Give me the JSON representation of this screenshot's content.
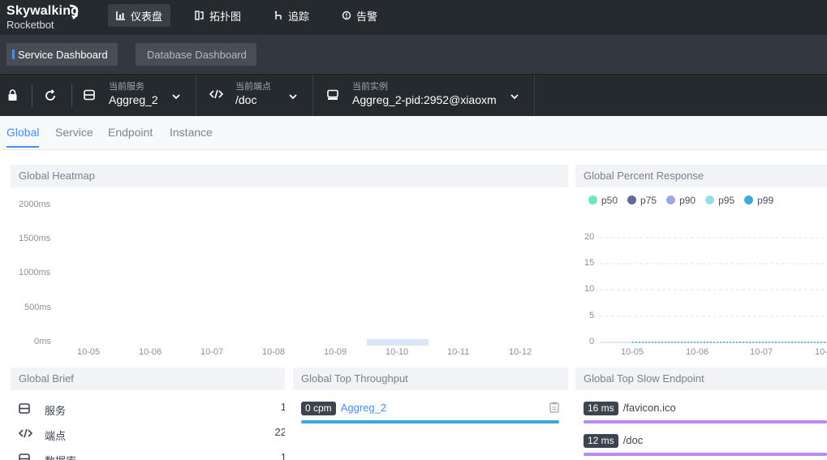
{
  "app": {
    "logo_line1": "Skywalking",
    "logo_line2": "Rocketbot"
  },
  "nav": [
    {
      "label": "仪表盘",
      "icon": "chart-icon"
    },
    {
      "label": "拓扑图",
      "icon": "topology-icon"
    },
    {
      "label": "追踪",
      "icon": "trace-icon"
    },
    {
      "label": "告警",
      "icon": "alarm-icon"
    }
  ],
  "dashboards": [
    "Service Dashboard",
    "Database Dashboard"
  ],
  "selectors": {
    "service": {
      "caption": "当前服务",
      "value": "Aggreg_2"
    },
    "endpoint": {
      "caption": "当前端点",
      "value": "/doc"
    },
    "instance": {
      "caption": "当前实例",
      "value": "Aggreg_2-pid:2952@xiaoxm"
    }
  },
  "subtabs": [
    "Global",
    "Service",
    "Endpoint",
    "Instance"
  ],
  "heatmap": {
    "title": "Global Heatmap",
    "y_labels": [
      "2000ms",
      "1500ms",
      "1000ms",
      "500ms",
      "0ms"
    ],
    "x_labels": [
      "10-05",
      "10-06",
      "10-07",
      "10-08",
      "10-09",
      "10-10",
      "10-11",
      "10-12"
    ]
  },
  "percent": {
    "title": "Global Percent Response",
    "legend": [
      {
        "name": "p50",
        "color": "#6be6c1"
      },
      {
        "name": "p75",
        "color": "#626c91"
      },
      {
        "name": "p90",
        "color": "#a0a7e6"
      },
      {
        "name": "p95",
        "color": "#96dee8"
      },
      {
        "name": "p99",
        "color": "#3fa7dc"
      }
    ],
    "y_labels": [
      "20",
      "15",
      "10",
      "5",
      "0"
    ],
    "x_labels": [
      "10-05",
      "10-06",
      "10-07",
      "10-"
    ]
  },
  "brief": {
    "title": "Global Brief",
    "rows": [
      {
        "label": "服务",
        "value": "1",
        "icon": "database-icon"
      },
      {
        "label": "端点",
        "value": "22",
        "icon": "code-icon"
      },
      {
        "label": "数据库",
        "value": "1",
        "icon": "database-icon"
      }
    ]
  },
  "throughput": {
    "title": "Global Top Throughput",
    "items": [
      {
        "badge": "0 cpm",
        "name": "Aggreg_2"
      }
    ]
  },
  "slow": {
    "title": "Global Top Slow Endpoint",
    "items": [
      {
        "badge": "16 ms",
        "path": "/favicon.ico"
      },
      {
        "badge": "12 ms",
        "path": "/doc"
      }
    ]
  },
  "colors": {
    "accent": "#448dfe",
    "topbar": "#252a2f",
    "throughput_bar": "#3aa8e0",
    "slow_bar": "#b98bf2",
    "heatmap_cell": "#d8e6f6"
  },
  "chart_data": [
    {
      "type": "heatmap",
      "title": "Global Heatmap",
      "categories": [
        "10-05",
        "10-06",
        "10-07",
        "10-08",
        "10-09",
        "10-10",
        "10-11",
        "10-12"
      ],
      "y_ticks": [
        "0ms",
        "500ms",
        "1000ms",
        "1500ms",
        "2000ms"
      ],
      "ylim": [
        0,
        2000
      ],
      "cells": [
        {
          "x": "10-10",
          "y_range": [
            0,
            100
          ]
        }
      ]
    },
    {
      "type": "line",
      "title": "Global Percent Response",
      "x": [
        "10-05",
        "10-06",
        "10-07"
      ],
      "ylim": [
        0,
        20
      ],
      "series": [
        {
          "name": "p50",
          "values": [
            0,
            0,
            0
          ]
        },
        {
          "name": "p75",
          "values": [
            0,
            0,
            0
          ]
        },
        {
          "name": "p90",
          "values": [
            0,
            0,
            0
          ]
        },
        {
          "name": "p95",
          "values": [
            0,
            0,
            0
          ]
        },
        {
          "name": "p99",
          "values": [
            0,
            0,
            0
          ]
        }
      ]
    }
  ]
}
